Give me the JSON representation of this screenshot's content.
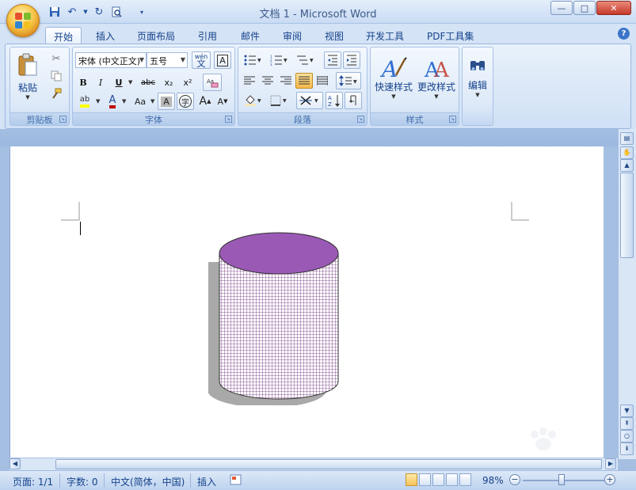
{
  "window": {
    "title": "文档 1 - Microsoft Word",
    "controls": {
      "minimize": "—",
      "maximize": "□",
      "close": "✕"
    }
  },
  "quick_access": {
    "icons": [
      "save-icon",
      "undo-icon",
      "redo-icon",
      "print-preview-icon",
      "customize-dropdown-icon"
    ]
  },
  "tabs": [
    {
      "label": "开始",
      "active": true
    },
    {
      "label": "插入",
      "active": false
    },
    {
      "label": "页面布局",
      "active": false
    },
    {
      "label": "引用",
      "active": false
    },
    {
      "label": "邮件",
      "active": false
    },
    {
      "label": "审阅",
      "active": false
    },
    {
      "label": "视图",
      "active": false
    },
    {
      "label": "开发工具",
      "active": false
    },
    {
      "label": "PDF工具集",
      "active": false
    }
  ],
  "ribbon": {
    "clipboard": {
      "label": "剪贴板",
      "paste_label": "粘贴"
    },
    "font": {
      "label": "字体",
      "font_name": "宋体 (中文正文)",
      "font_size": "五号",
      "phonetic_label": "wén",
      "bold": "B",
      "italic": "I",
      "underline": "U",
      "strike": "abc",
      "subscript": "x₂",
      "superscript": "x²",
      "highlight": "ab",
      "font_color": "A",
      "change_case": "Aa",
      "char_shade": "A",
      "enclose": "字",
      "grow": "A",
      "shrink": "A"
    },
    "paragraph": {
      "label": "段落"
    },
    "styles": {
      "label": "样式",
      "quick_styles": "快速样式",
      "change_styles": "更改样式"
    },
    "editing": {
      "label": "编辑",
      "edit": "编辑"
    }
  },
  "document": {
    "shape": {
      "type": "cylinder",
      "top_color": "#9b59b6",
      "body_pattern": "grid",
      "body_color": "#6a2a7a"
    }
  },
  "status": {
    "page": "页面: 1/1",
    "words": "字数: 0",
    "language": "中文(简体，中国)",
    "mode": "插入",
    "zoom": "98%"
  },
  "colors": {
    "ribbon_text": "#15428b",
    "highlight_yellow": "#ffff00",
    "font_color_red": "#c00000",
    "cylinder_top": "#9b59b6"
  }
}
